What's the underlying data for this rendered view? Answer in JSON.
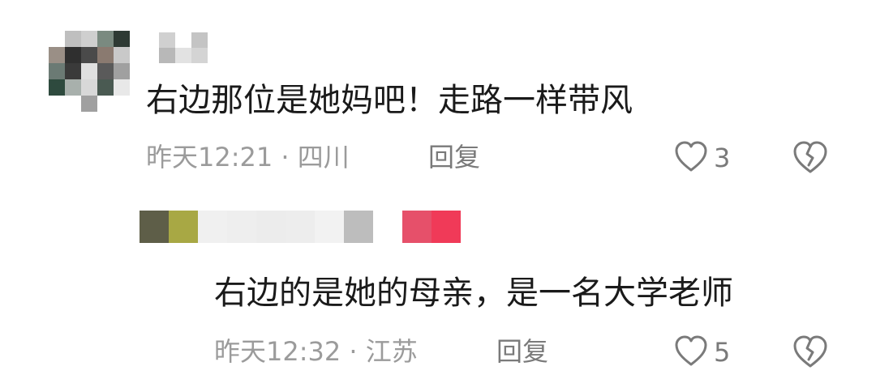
{
  "comments": [
    {
      "text": "右边那位是她妈吧！走路一样带风",
      "meta": "昨天12:21 · 四川",
      "reply_label": "回复",
      "likes": "3",
      "like_icon": "heart-outline-icon",
      "dislike_icon": "broken-heart-icon"
    },
    {
      "text": "右边的是她的母亲，是一名大学老师",
      "meta": "昨天12:32 · 江苏",
      "reply_label": "回复",
      "likes": "5",
      "like_icon": "heart-outline-icon",
      "dislike_icon": "broken-heart-icon"
    }
  ],
  "colors": {
    "text": "#1a1a1a",
    "meta": "#9b9b9b",
    "icon": "#7a7a7a"
  }
}
